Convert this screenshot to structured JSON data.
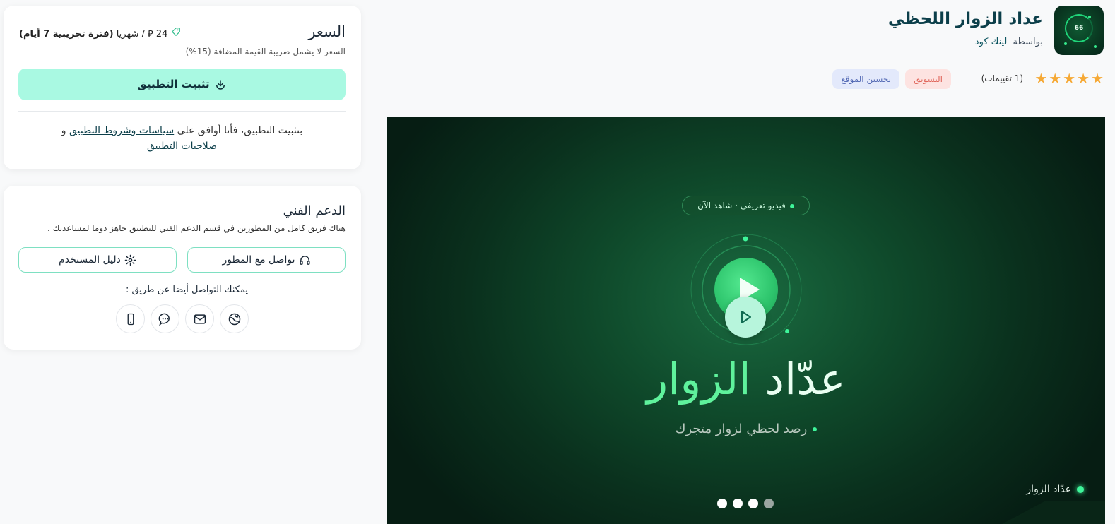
{
  "app": {
    "title": "عداد الزوار اللحظي",
    "by_label": "بواسطة",
    "developer": "لينك كود",
    "icon_number": "66",
    "rating_count": "(1 تقييمات)",
    "stars": 5,
    "tags": [
      "التسويق",
      "تحسين الموقع"
    ]
  },
  "video": {
    "pill_text": "فيديو تعريفي · شاهد الآن",
    "title_part1": "عدّاد",
    "title_part2": "الزوار",
    "subtitle": "رصد لحظي لزوار متجرك",
    "brand": "عدّاد الزوار",
    "slides": 4,
    "active_slide": 4
  },
  "price": {
    "title": "السعر",
    "amount": "24",
    "currency_symbol": "⃁",
    "period": "/ شهريا",
    "trial": "(فترة تجريبية 7 أيام)",
    "vat_note": "السعر لا يشمل ضريبة القيمة المضافة (15%)",
    "install_label": "تثبيت التطبيق",
    "terms_prefix": "بتثبيت التطبيق، فأنا أوافق على",
    "terms_link1": "سياسات وشروط التطبيق",
    "terms_and": "و",
    "terms_link2": "صلاحيات التطبيق"
  },
  "support": {
    "title": "الدعم الفني",
    "description": "هناك فريق كامل من المطورين في قسم الدعم الفني للتطبيق جاهز دوما لمساعدتك .",
    "contact_dev_label": "تواصل مع المطور",
    "user_guide_label": "دليل المستخدم",
    "contact_also_label": "يمكنك التواصل أيضا عن طريق :",
    "channels": [
      "website-icon",
      "email-icon",
      "chat-icon",
      "phone-icon"
    ]
  },
  "colors": {
    "accent": "#a9f9e2",
    "star": "#f6a935",
    "brand_green": "#3ef59a"
  }
}
